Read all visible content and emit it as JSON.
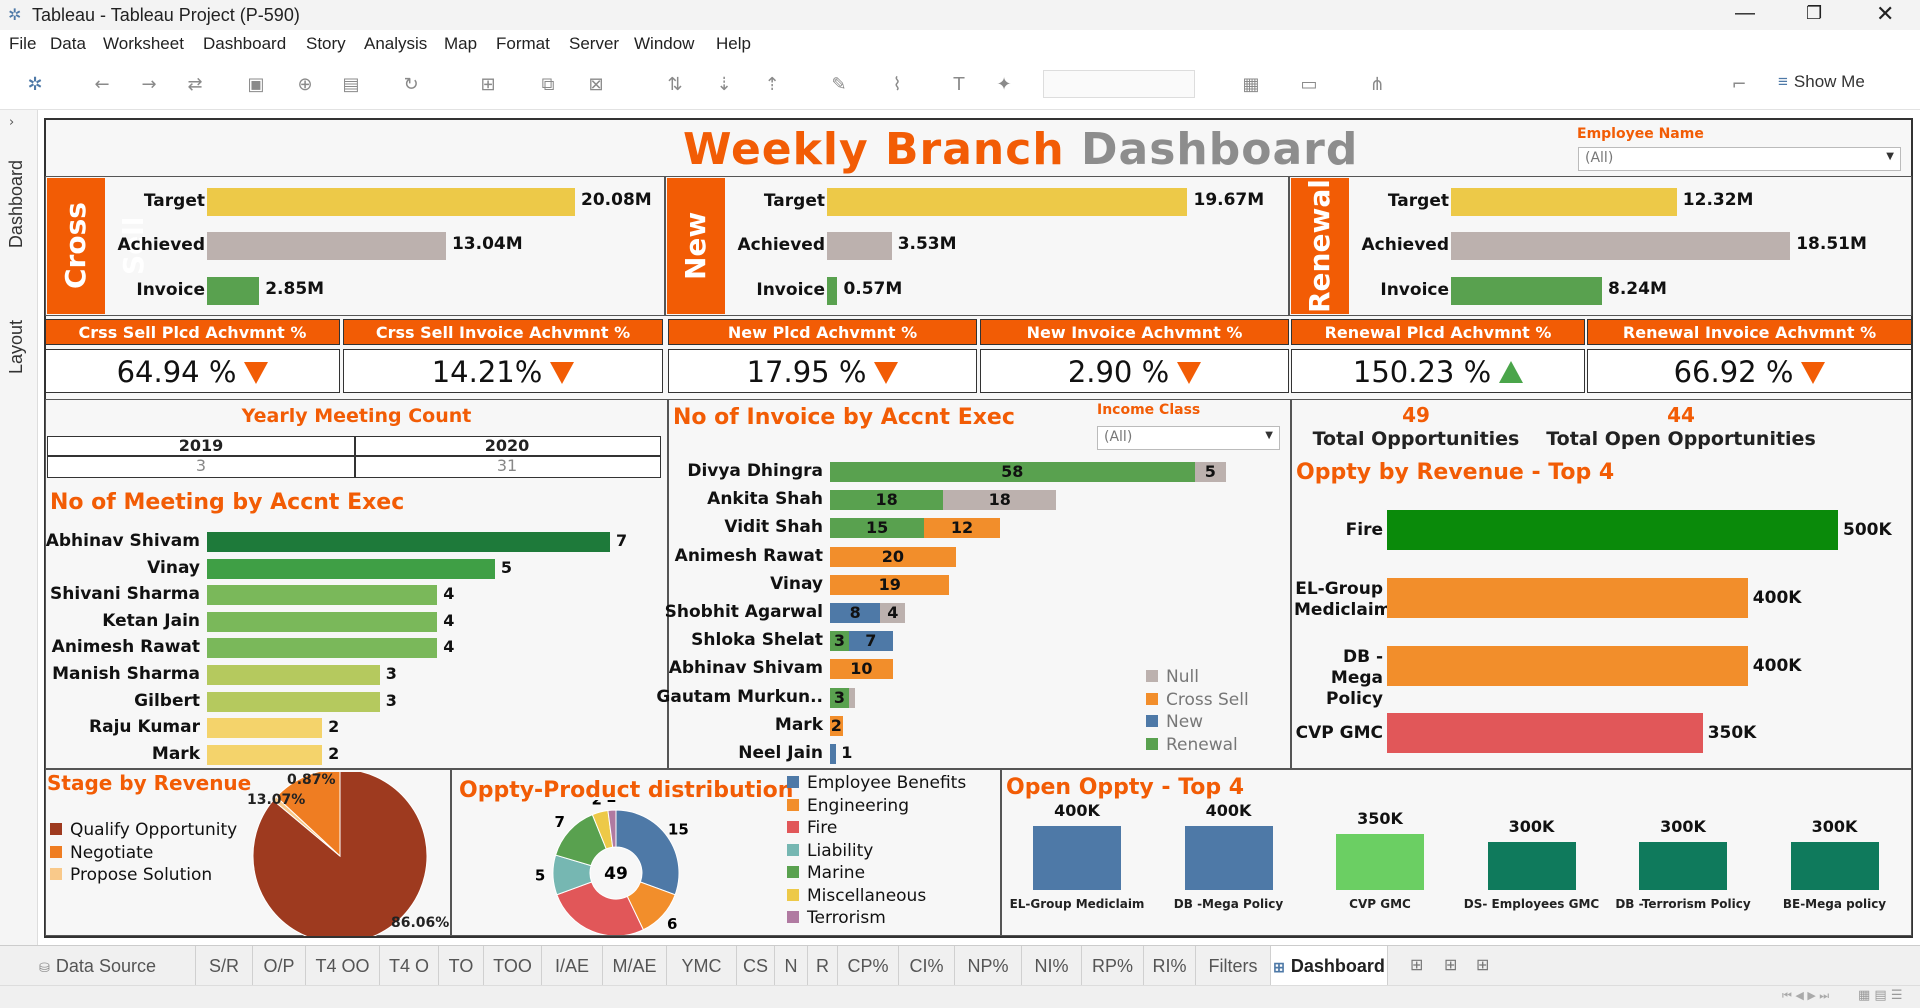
{
  "window": {
    "title": "Tableau - Tableau Project (P-590)"
  },
  "menu": [
    "File",
    "Data",
    "Worksheet",
    "Dashboard",
    "Story",
    "Analysis",
    "Map",
    "Format",
    "Server",
    "Window",
    "Help"
  ],
  "toolbar": {
    "show_me": "Show Me"
  },
  "side_tabs": [
    "Dashboard",
    "Layout"
  ],
  "dashboard": {
    "title_part1": "Weekly Branch",
    "title_part2": "Dashboard",
    "employee_filter": {
      "label": "Employee Name",
      "value": "(All)"
    },
    "sections": [
      {
        "name": "Cross Sell",
        "rows": [
          {
            "label": "Target",
            "value": "20.08M",
            "num": 20.08
          },
          {
            "label": "Achieved",
            "value": "13.04M",
            "num": 13.04
          },
          {
            "label": "Invoice",
            "value": "2.85M",
            "num": 2.85
          }
        ]
      },
      {
        "name": "New",
        "rows": [
          {
            "label": "Target",
            "value": "19.67M",
            "num": 19.67
          },
          {
            "label": "Achieved",
            "value": "3.53M",
            "num": 3.53
          },
          {
            "label": "Invoice",
            "value": "0.57M",
            "num": 0.57
          }
        ]
      },
      {
        "name": "Renewal",
        "rows": [
          {
            "label": "Target",
            "value": "12.32M",
            "num": 12.32
          },
          {
            "label": "Achieved",
            "value": "18.51M",
            "num": 18.51
          },
          {
            "label": "Invoice",
            "value": "8.24M",
            "num": 8.24
          }
        ]
      }
    ],
    "kpis": [
      {
        "header": "Crss Sell Plcd Achvmnt %",
        "value": "64.94 %",
        "trend": "down"
      },
      {
        "header": "Crss Sell Invoice Achvmnt %",
        "value": "14.21%",
        "trend": "down"
      },
      {
        "header": "New Plcd Achvmnt %",
        "value": "17.95 %",
        "trend": "down"
      },
      {
        "header": "New Invoice Achvmnt %",
        "value": "2.90 %",
        "trend": "down"
      },
      {
        "header": "Renewal Plcd Achvmnt %",
        "value": "150.23 %",
        "trend": "up"
      },
      {
        "header": "Renewal Invoice Achvmnt %",
        "value": "66.92 %",
        "trend": "down"
      }
    ],
    "yearly_meeting": {
      "title": "Yearly Meeting Count",
      "years": [
        "2019",
        "2020"
      ],
      "counts": [
        "3",
        "31"
      ]
    },
    "meetings": {
      "title": "No of Meeting by Accnt Exec",
      "rows": [
        {
          "name": "Abhinav Shivam",
          "value": 7,
          "color": "#1e7a3a"
        },
        {
          "name": "Vinay",
          "value": 5,
          "color": "#3f9f45"
        },
        {
          "name": "Shivani Sharma",
          "value": 4,
          "color": "#7ab85a"
        },
        {
          "name": "Ketan Jain",
          "value": 4,
          "color": "#7ab85a"
        },
        {
          "name": "Animesh Rawat",
          "value": 4,
          "color": "#7ab85a"
        },
        {
          "name": "Manish Sharma",
          "value": 3,
          "color": "#b5c95e"
        },
        {
          "name": "Gilbert",
          "value": 3,
          "color": "#b5c95e"
        },
        {
          "name": "Raju Kumar",
          "value": 2,
          "color": "#f4d36b"
        },
        {
          "name": "Mark",
          "value": 2,
          "color": "#f4d36b"
        }
      ]
    },
    "invoices": {
      "title": "No of Invoice by Accnt Exec",
      "filter_label": "Income Class",
      "filter_value": "(All)",
      "legend": [
        {
          "name": "Null",
          "color": "#bcb1ae"
        },
        {
          "name": "Cross Sell",
          "color": "#f28e2b"
        },
        {
          "name": "New",
          "color": "#4e79a7"
        },
        {
          "name": "Renewal",
          "color": "#59a14f"
        }
      ],
      "rows": [
        {
          "name": "Divya Dhingra",
          "segments": [
            {
              "v": 58,
              "c": "#59a14f",
              "l": "58"
            },
            {
              "v": 5,
              "c": "#bcb1ae",
              "l": "5"
            }
          ]
        },
        {
          "name": "Ankita Shah",
          "segments": [
            {
              "v": 18,
              "c": "#59a14f",
              "l": "18"
            },
            {
              "v": 18,
              "c": "#bcb1ae",
              "l": "18"
            }
          ]
        },
        {
          "name": "Vidit Shah",
          "segments": [
            {
              "v": 15,
              "c": "#59a14f",
              "l": "15"
            },
            {
              "v": 12,
              "c": "#f28e2b",
              "l": "12"
            }
          ]
        },
        {
          "name": "Animesh Rawat",
          "segments": [
            {
              "v": 20,
              "c": "#f28e2b",
              "l": "20"
            }
          ]
        },
        {
          "name": "Vinay",
          "segments": [
            {
              "v": 19,
              "c": "#f28e2b",
              "l": "19"
            }
          ]
        },
        {
          "name": "Shobhit Agarwal",
          "segments": [
            {
              "v": 8,
              "c": "#4e79a7",
              "l": "8"
            },
            {
              "v": 4,
              "c": "#bcb1ae",
              "l": "4"
            }
          ]
        },
        {
          "name": "Shloka Shelat",
          "segments": [
            {
              "v": 3,
              "c": "#59a14f",
              "l": "3"
            },
            {
              "v": 7,
              "c": "#4e79a7",
              "l": "7"
            }
          ]
        },
        {
          "name": "Abhinav Shivam",
          "segments": [
            {
              "v": 10,
              "c": "#f28e2b",
              "l": "10"
            }
          ]
        },
        {
          "name": "Gautam Murkun..",
          "segments": [
            {
              "v": 3,
              "c": "#59a14f",
              "l": "3"
            },
            {
              "v": 1,
              "c": "#bcb1ae",
              "l": ""
            }
          ]
        },
        {
          "name": "Mark",
          "segments": [
            {
              "v": 2,
              "c": "#f28e2b",
              "l": "2"
            }
          ]
        },
        {
          "name": "Neel Jain",
          "segments": [
            {
              "v": 1,
              "c": "#4e79a7",
              "l": ""
            }
          ],
          "outside": "1"
        }
      ]
    },
    "opportunities": {
      "total": "49",
      "total_label": "Total Opportunities",
      "open": "44",
      "open_label": "Total Open Opportunities"
    },
    "oppty_revenue": {
      "title": "Oppty by Revenue - Top 4",
      "rows": [
        {
          "name": "Fire",
          "value": 500,
          "label": "500K",
          "color": "#0a8a0a"
        },
        {
          "name": "EL-Group Mediclaim",
          "value": 400,
          "label": "400K",
          "color": "#f28e2b"
        },
        {
          "name": "DB -Mega Policy",
          "value": 400,
          "label": "400K",
          "color": "#f28e2b"
        },
        {
          "name": "CVP GMC",
          "value": 350,
          "label": "350K",
          "color": "#e15759"
        }
      ]
    },
    "stage_revenue": {
      "title": "Stage by Revenue",
      "legend": [
        {
          "name": "Qualify Opportunity",
          "color": "#9e3a1f"
        },
        {
          "name": "Negotiate",
          "color": "#ef7d22"
        },
        {
          "name": "Propose Solution",
          "color": "#f9c98a"
        }
      ],
      "slices": [
        {
          "pct": 86.06,
          "label": "86.06%",
          "color": "#9e3a1f"
        },
        {
          "pct": 13.07,
          "label": "13.07%",
          "color": "#ef7d22"
        },
        {
          "pct": 0.87,
          "label": "0.87%",
          "color": "#f9c98a"
        }
      ]
    },
    "product_dist": {
      "title": "Oppty-Product distribution",
      "center": "49",
      "slices": [
        {
          "name": "Employee Benefits",
          "value": 15,
          "color": "#4e79a7"
        },
        {
          "name": "Engineering",
          "value": 6,
          "color": "#f28e2b"
        },
        {
          "name": "Fire",
          "value": 13,
          "color": "#e15759"
        },
        {
          "name": "Liability",
          "value": 5,
          "color": "#76b7b2"
        },
        {
          "name": "Marine",
          "value": 7,
          "color": "#59a14f"
        },
        {
          "name": "Miscellaneous",
          "value": 2,
          "color": "#edc948"
        },
        {
          "name": "Terrorism",
          "value": 1,
          "color": "#b07aa1"
        }
      ]
    },
    "open_oppty": {
      "title": "Open Oppty - Top 4",
      "rows": [
        {
          "name": "EL-Group Mediclaim",
          "value": 400,
          "label": "400K",
          "color": "#4e79a7"
        },
        {
          "name": "DB -Mega Policy",
          "value": 400,
          "label": "400K",
          "color": "#4e79a7"
        },
        {
          "name": "CVP GMC",
          "value": 350,
          "label": "350K",
          "color": "#6bcf63"
        },
        {
          "name": "DS- Employees GMC",
          "value": 300,
          "label": "300K",
          "color": "#0f7a5c"
        },
        {
          "name": "DB -Terrorism Policy",
          "value": 300,
          "label": "300K",
          "color": "#0f7a5c"
        },
        {
          "name": "BE-Mega policy",
          "value": 300,
          "label": "300K",
          "color": "#0f7a5c"
        }
      ]
    }
  },
  "bottom_tabs": [
    "Data Source",
    "S/R",
    "O/P",
    "T4 OO",
    "T4 O",
    "TO",
    "TOO",
    "I/AE",
    "M/AE",
    "YMC",
    "CS",
    "N",
    "R",
    "CP%",
    "CI%",
    "NP%",
    "NI%",
    "RP%",
    "RI%",
    "Filters",
    "Dashboard"
  ]
}
